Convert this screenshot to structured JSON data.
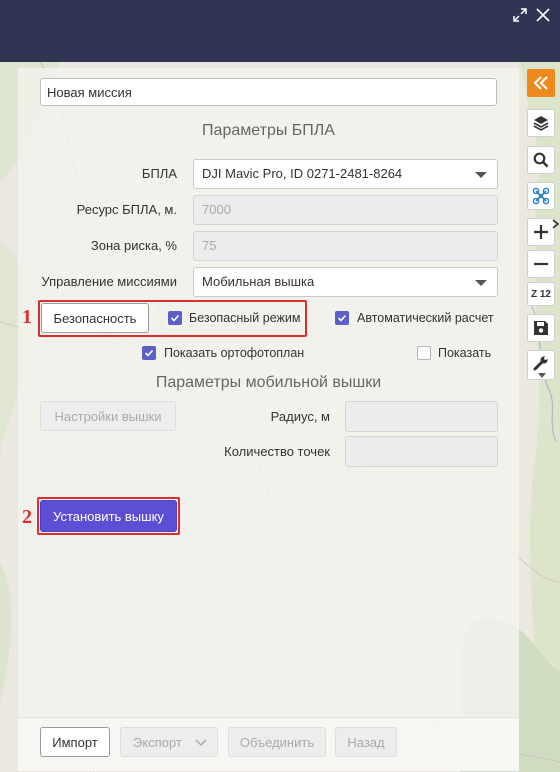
{
  "mission": {
    "name_value": "Новая миссия"
  },
  "uav_section": {
    "title": "Параметры БПЛА",
    "uav_label": "БПЛА",
    "uav_value": "DJI Mavic Pro, ID 0271-2481-8264",
    "resource_label": "Ресурс БПЛА, м.",
    "resource_value": "7000",
    "risk_label": "Зона риска, %",
    "risk_value": "75",
    "control_label": "Управление миссиями",
    "control_value": "Мобильная вышка",
    "safety_button": "Безопасность",
    "safe_mode_label": "Безопасный режим",
    "safe_mode_checked": true,
    "auto_calc_label": "Автоматический расчет",
    "auto_calc_checked": true,
    "orthophoto_label": "Показать ортофотоплан",
    "orthophoto_checked": true,
    "show_label": "Показать",
    "show_checked": false
  },
  "tower_section": {
    "title": "Параметры мобильной вышки",
    "settings_button": "Настройки вышки",
    "radius_label": "Радиус, м",
    "radius_value": "",
    "points_label": "Количество точек",
    "points_value": "",
    "install_button": "Установить вышку"
  },
  "annotations": {
    "marker_1": "1",
    "marker_2": "2"
  },
  "footer": {
    "import_button": "Импорт",
    "export_button": "Экспорт",
    "merge_button": "Объединить",
    "back_button": "Назад"
  },
  "toolbar": {
    "collapse": "chevrons-left-icon",
    "layers": "layers-icon",
    "search": "search-icon",
    "drone": "drone-icon",
    "zoom_in": "plus-icon",
    "zoom_out": "minus-icon",
    "zoom_level": "Z 12",
    "save": "save-icon",
    "settings": "wrench-icon"
  },
  "window": {
    "expand": "expand-icon",
    "close": "close-icon"
  },
  "colors": {
    "titlebar": "#2f3553",
    "primary": "#5c4fd6",
    "highlight": "#d9302d",
    "accent_orange": "#ef8a1e"
  }
}
